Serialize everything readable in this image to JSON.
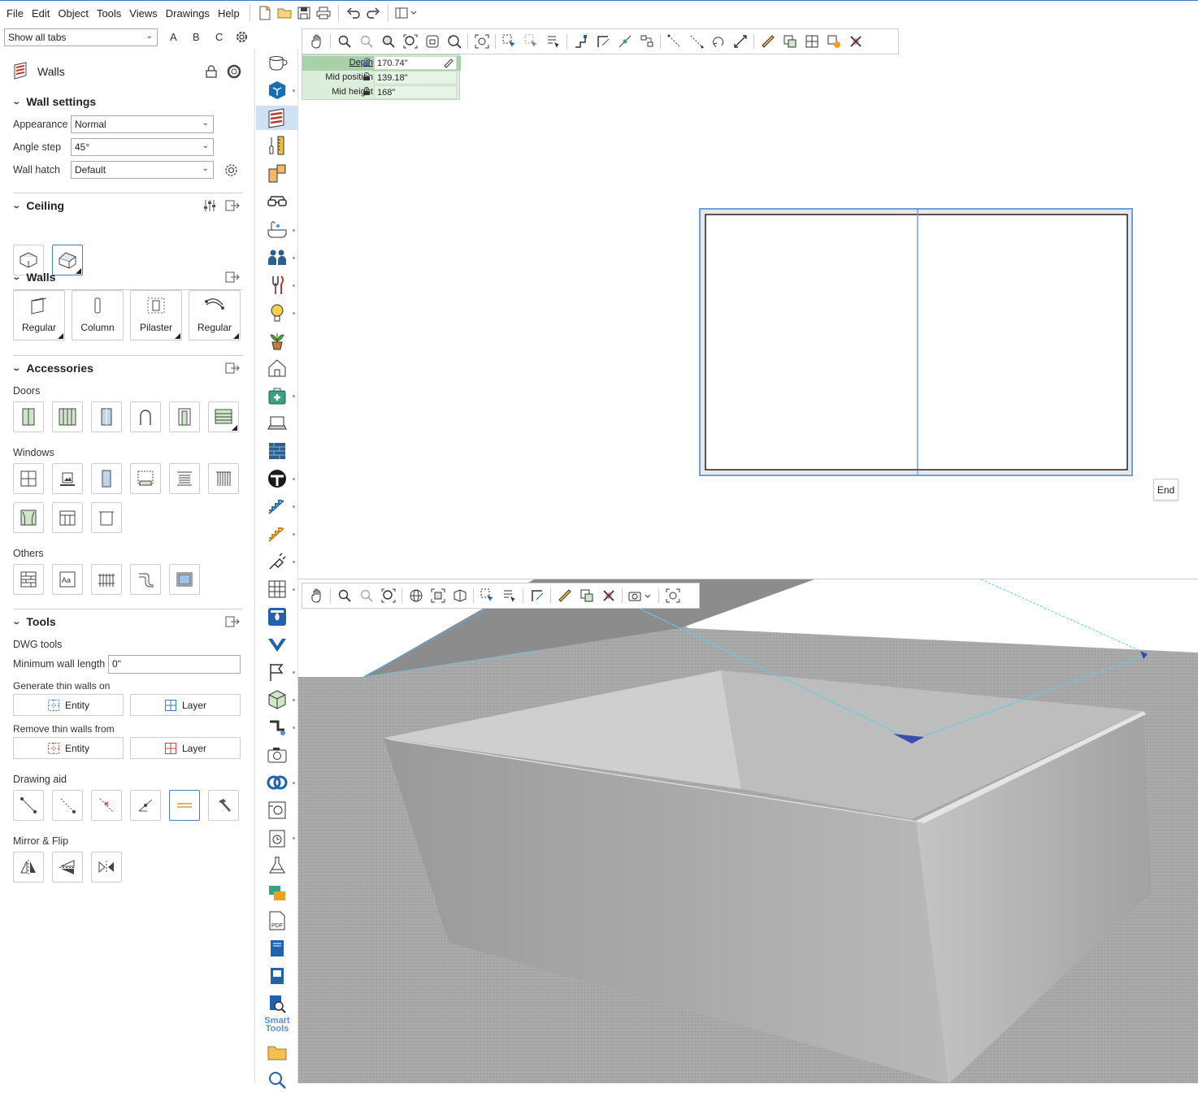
{
  "menu": [
    "File",
    "Edit",
    "Object",
    "Tools",
    "Views",
    "Drawings",
    "Help"
  ],
  "tabs_selector": {
    "value": "Show all tabs",
    "letters": [
      "A",
      "B",
      "C"
    ]
  },
  "panel": {
    "title": "Walls",
    "wall_settings": {
      "heading": "Wall settings",
      "appearance_label": "Appearance",
      "appearance_value": "Normal",
      "angle_label": "Angle step",
      "angle_value": "45°",
      "hatch_label": "Wall hatch",
      "hatch_value": "Default"
    },
    "ceiling": {
      "heading": "Ceiling"
    },
    "walls": {
      "heading": "Walls",
      "buttons": [
        "Regular",
        "Column",
        "Pilaster",
        "Regular"
      ]
    },
    "accessories": {
      "heading": "Accessories",
      "doors": "Doors",
      "windows": "Windows",
      "others": "Others"
    },
    "tools": {
      "heading": "Tools",
      "dwg": "DWG tools",
      "min_len_label": "Minimum wall length",
      "min_len_value": "0\"",
      "generate_label": "Generate thin walls on",
      "remove_label": "Remove thin walls from",
      "entity": "Entity",
      "layer": "Layer",
      "drawing_aid": "Drawing aid",
      "mirror": "Mirror & Flip"
    }
  },
  "dimensions": [
    {
      "label": "Depth",
      "value": "170.74\""
    },
    {
      "label": "Mid position",
      "value": "139.18\""
    },
    {
      "label": "Mid height",
      "value": "168\""
    }
  ],
  "tooltip": "End",
  "smart_tools": "Smart Tools",
  "colors": {
    "accent": "#4a90e2",
    "selection": "#6a9ee6",
    "dimbox": "#dbeedb"
  }
}
